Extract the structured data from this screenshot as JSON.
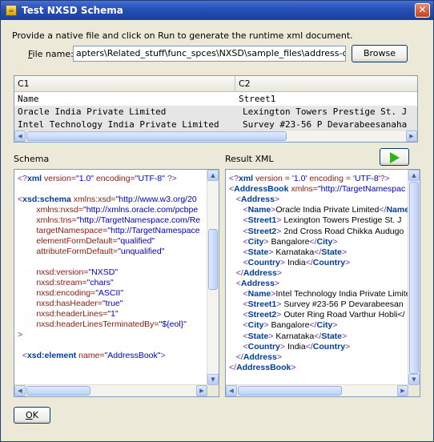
{
  "window": {
    "title": "Test NXSD Schema",
    "close_glyph": "✕"
  },
  "instructions": "Provide a native file and click on Run to generate the runtime xml document.",
  "file_name": {
    "label_prefix": "F",
    "label_rest": "ile name:",
    "value": "apters\\Related_stuff\\func_spces\\NXSD\\sample_files\\address-csv.txt",
    "browse_label": "Browse"
  },
  "grid": {
    "columns": [
      "C1",
      "C2"
    ],
    "rows": [
      [
        "Name",
        "Street1"
      ],
      [
        "Oracle India Private Limited",
        "Lexington Towers Prestige St. J"
      ],
      [
        "Intel Technology India Private Limited",
        "Survey #23-56 P Devarabeesanaha"
      ]
    ]
  },
  "schema": {
    "label": "Schema",
    "lines": [
      [
        [
          "<?",
          "pi"
        ],
        [
          "xml",
          "tag"
        ],
        [
          " version=",
          "attr"
        ],
        [
          "\"1.0\"",
          "val"
        ],
        [
          " encoding=",
          "attr"
        ],
        [
          "\"UTF-8\"",
          "val"
        ],
        [
          " ?>",
          "pi"
        ]
      ],
      [],
      [
        [
          "<",
          "pi"
        ],
        [
          "xsd:schema",
          "tag"
        ],
        [
          " xmlns:xsd=",
          "attr"
        ],
        [
          "\"http://www.w3.org/20",
          "val"
        ]
      ],
      [
        [
          "        xmlns:nxsd=",
          "attr"
        ],
        [
          "\"http://xmlns.oracle.com/pcbpe",
          "val"
        ]
      ],
      [
        [
          "        xmlns:tns=",
          "attr"
        ],
        [
          "\"http://TargetNamespace.com/Re",
          "val"
        ]
      ],
      [
        [
          "        targetNamespace=",
          "attr"
        ],
        [
          "\"http://TargetNamespace",
          "val"
        ]
      ],
      [
        [
          "        elementFormDefault=",
          "attr"
        ],
        [
          "\"qualified\"",
          "val"
        ]
      ],
      [
        [
          "        attributeFormDefault=",
          "attr"
        ],
        [
          "\"unqualified\"",
          "val"
        ]
      ],
      [],
      [
        [
          "        nxsd:version=",
          "attr"
        ],
        [
          "\"NXSD\"",
          "val"
        ]
      ],
      [
        [
          "        nxsd:stream=",
          "attr"
        ],
        [
          "\"chars\"",
          "val"
        ]
      ],
      [
        [
          "        nxsd:encoding=",
          "attr"
        ],
        [
          "\"ASCII\"",
          "val"
        ]
      ],
      [
        [
          "        nxsd:hasHeader=",
          "attr"
        ],
        [
          "\"true\"",
          "val"
        ]
      ],
      [
        [
          "        nxsd:headerLines=",
          "attr"
        ],
        [
          "\"1\"",
          "val"
        ]
      ],
      [
        [
          "        nxsd:headerLinesTerminatedBy=",
          "attr"
        ],
        [
          "\"${eol}\"",
          "val"
        ]
      ],
      [
        [
          ">",
          "pi"
        ]
      ],
      [],
      [
        [
          "  <",
          "pi"
        ],
        [
          "xsd:element",
          "tag"
        ],
        [
          " name=",
          "attr"
        ],
        [
          "\"AddressBook\"",
          "val"
        ],
        [
          ">",
          "pi"
        ]
      ]
    ]
  },
  "result": {
    "label": "Result XML",
    "lines": [
      [
        [
          "<?",
          "pi"
        ],
        [
          "xml",
          "tag"
        ],
        [
          " version = ",
          "attr"
        ],
        [
          "'1.0'",
          "val"
        ],
        [
          " encoding = ",
          "attr"
        ],
        [
          "'UTF-8'",
          "val"
        ],
        [
          "?>",
          "pi"
        ]
      ],
      [
        [
          "<",
          "pi"
        ],
        [
          "AddressBook",
          "tag"
        ],
        [
          " xmlns=",
          "attr"
        ],
        [
          "\"http://TargetNamespac",
          "val"
        ]
      ],
      [
        [
          "   <",
          "pi"
        ],
        [
          "Address",
          "tag"
        ],
        [
          ">",
          "pi"
        ]
      ],
      [
        [
          "      <",
          "pi"
        ],
        [
          "Name",
          "tag"
        ],
        [
          ">",
          "pi"
        ],
        [
          "Oracle India Private Limited",
          "plain"
        ],
        [
          "</",
          "pi"
        ],
        [
          "Name",
          "tag"
        ]
      ],
      [
        [
          "      <",
          "pi"
        ],
        [
          "Street1",
          "tag"
        ],
        [
          "> ",
          "pi"
        ],
        [
          "Lexington Towers Prestige St. J",
          "plain"
        ]
      ],
      [
        [
          "      <",
          "pi"
        ],
        [
          "Street2",
          "tag"
        ],
        [
          "> ",
          "pi"
        ],
        [
          "2nd Cross Road Chikka Audugo",
          "plain"
        ]
      ],
      [
        [
          "      <",
          "pi"
        ],
        [
          "City",
          "tag"
        ],
        [
          "> ",
          "pi"
        ],
        [
          "Bangalore",
          "plain"
        ],
        [
          "</",
          "pi"
        ],
        [
          "City",
          "tag"
        ],
        [
          ">",
          "pi"
        ]
      ],
      [
        [
          "      <",
          "pi"
        ],
        [
          "State",
          "tag"
        ],
        [
          "> ",
          "pi"
        ],
        [
          "Karnataka",
          "plain"
        ],
        [
          "</",
          "pi"
        ],
        [
          "State",
          "tag"
        ],
        [
          ">",
          "pi"
        ]
      ],
      [
        [
          "      <",
          "pi"
        ],
        [
          "Country",
          "tag"
        ],
        [
          "> ",
          "pi"
        ],
        [
          "India",
          "plain"
        ],
        [
          "</",
          "pi"
        ],
        [
          "Country",
          "tag"
        ],
        [
          ">",
          "pi"
        ]
      ],
      [
        [
          "   </",
          "pi"
        ],
        [
          "Address",
          "tag"
        ],
        [
          ">",
          "pi"
        ]
      ],
      [
        [
          "   <",
          "pi"
        ],
        [
          "Address",
          "tag"
        ],
        [
          ">",
          "pi"
        ]
      ],
      [
        [
          "      <",
          "pi"
        ],
        [
          "Name",
          "tag"
        ],
        [
          ">",
          "pi"
        ],
        [
          "Intel Technology India Private Limite",
          "plain"
        ]
      ],
      [
        [
          "      <",
          "pi"
        ],
        [
          "Street1",
          "tag"
        ],
        [
          "> ",
          "pi"
        ],
        [
          "Survey #23-56 P Devarabeesan",
          "plain"
        ]
      ],
      [
        [
          "      <",
          "pi"
        ],
        [
          "Street2",
          "tag"
        ],
        [
          "> ",
          "pi"
        ],
        [
          "Outer Ring Road Varthur Hobli</",
          "plain"
        ]
      ],
      [
        [
          "      <",
          "pi"
        ],
        [
          "City",
          "tag"
        ],
        [
          "> ",
          "pi"
        ],
        [
          "Bangalore",
          "plain"
        ],
        [
          "</",
          "pi"
        ],
        [
          "City",
          "tag"
        ],
        [
          ">",
          "pi"
        ]
      ],
      [
        [
          "      <",
          "pi"
        ],
        [
          "State",
          "tag"
        ],
        [
          "> ",
          "pi"
        ],
        [
          "Karnataka",
          "plain"
        ],
        [
          "</",
          "pi"
        ],
        [
          "State",
          "tag"
        ],
        [
          ">",
          "pi"
        ]
      ],
      [
        [
          "      <",
          "pi"
        ],
        [
          "Country",
          "tag"
        ],
        [
          "> ",
          "pi"
        ],
        [
          "India",
          "plain"
        ],
        [
          "</",
          "pi"
        ],
        [
          "Country",
          "tag"
        ],
        [
          ">",
          "pi"
        ]
      ],
      [
        [
          "   </",
          "pi"
        ],
        [
          "Address",
          "tag"
        ],
        [
          ">",
          "pi"
        ]
      ],
      [
        [
          "</",
          "pi"
        ],
        [
          "AddressBook",
          "tag"
        ],
        [
          ">",
          "pi"
        ]
      ]
    ]
  },
  "buttons": {
    "ok_prefix": "O",
    "ok_rest": "K"
  },
  "colors": {
    "title_bar": "#2852b8",
    "run_arrow": "#2fb31b"
  },
  "icons": {
    "run": "play-icon",
    "close": "close-icon"
  }
}
